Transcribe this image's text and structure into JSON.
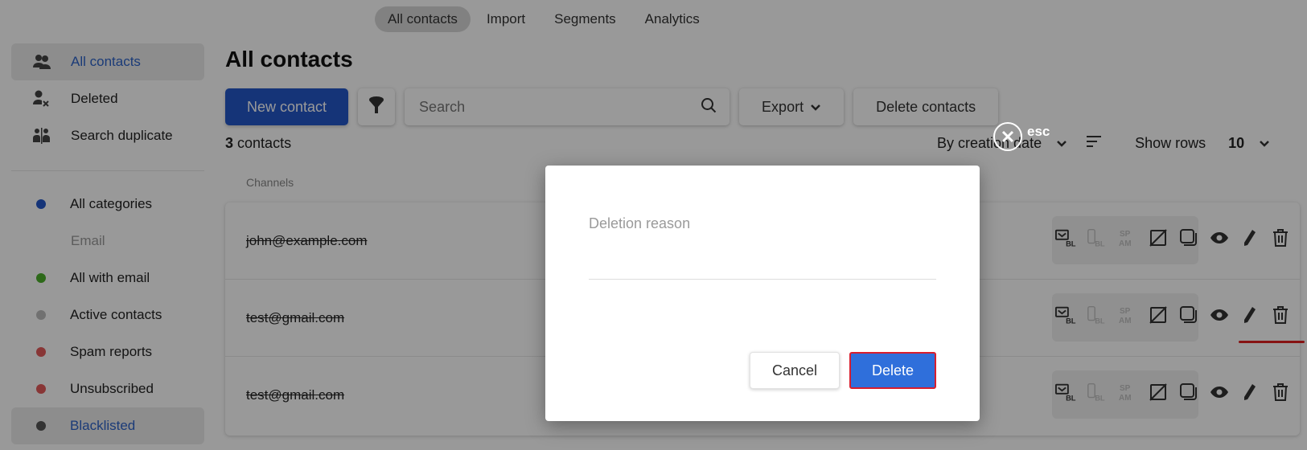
{
  "topnav": {
    "tabs": [
      {
        "label": "All contacts",
        "active": true
      },
      {
        "label": "Import",
        "active": false
      },
      {
        "label": "Segments",
        "active": false
      },
      {
        "label": "Analytics",
        "active": false
      }
    ]
  },
  "sidebar": {
    "items": [
      {
        "label": "All contacts",
        "icon": "contacts-icon",
        "active": true
      },
      {
        "label": "Deleted",
        "icon": "user-remove-icon",
        "active": false
      },
      {
        "label": "Search duplicate",
        "icon": "duplicate-icon",
        "active": false
      }
    ],
    "categories": [
      {
        "label": "All categories",
        "color": "#2357c9"
      },
      {
        "section": "Email"
      },
      {
        "label": "All with email",
        "color": "#4caf2a"
      },
      {
        "label": "Active contacts",
        "color": "#bdbdbd"
      },
      {
        "label": "Spam reports",
        "color": "#e35a5a"
      },
      {
        "label": "Unsubscribed",
        "color": "#e35a5a"
      },
      {
        "label": "Blacklisted",
        "color": "#555555",
        "active": true
      }
    ]
  },
  "main": {
    "title": "All contacts",
    "new_contact_label": "New contact",
    "search_placeholder": "Search",
    "export_label": "Export",
    "delete_contacts_label": "Delete contacts",
    "count_number": "3",
    "count_label": "contacts",
    "sort_label": "By creation date",
    "show_rows_label": "Show rows",
    "show_rows_value": "10",
    "column_header": "Channels"
  },
  "table": {
    "rows": [
      {
        "email": "john@example.com"
      },
      {
        "email": "test@gmail.com"
      },
      {
        "email": "test@gmail.com"
      }
    ],
    "channel_labels": {
      "bl": "BL",
      "spam_top": "SP",
      "spam_bottom": "AM"
    }
  },
  "overlay": {
    "esc_label": "esc"
  },
  "modal": {
    "reason_placeholder": "Deletion reason",
    "cancel_label": "Cancel",
    "delete_label": "Delete"
  },
  "colors": {
    "primary": "#2357c9",
    "delete_button": "#2f6fdb",
    "highlight_border": "#d81e2e"
  }
}
